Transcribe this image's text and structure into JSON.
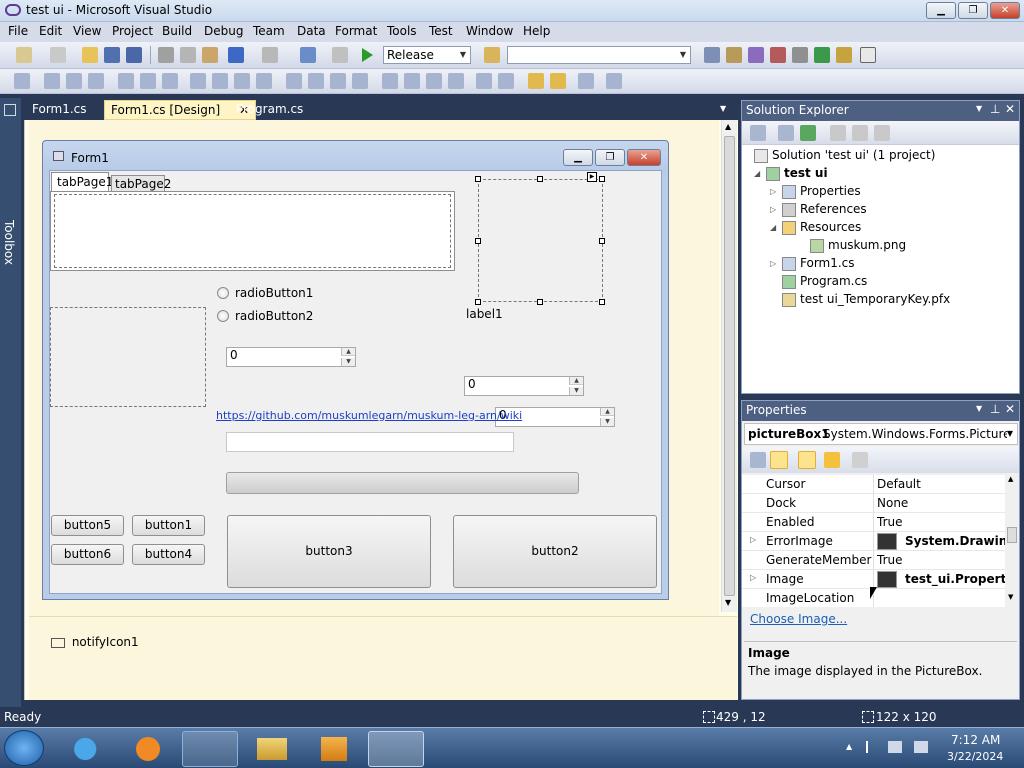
{
  "window": {
    "title": "test ui - Microsoft Visual Studio",
    "min": "▁",
    "max": "❐",
    "close": "✕"
  },
  "menu": [
    "File",
    "Edit",
    "View",
    "Project",
    "Build",
    "Debug",
    "Team",
    "Data",
    "Format",
    "Tools",
    "Test",
    "Window",
    "Help"
  ],
  "toolbar": {
    "config_value": "Release",
    "platform_value": ""
  },
  "toolbox": {
    "label": "Toolbox"
  },
  "doc_tabs": [
    {
      "label": "Form1.cs"
    },
    {
      "label": "Form1.cs [Design]"
    },
    {
      "label": "Program.cs"
    }
  ],
  "doc_tab_close": "✕",
  "form": {
    "title": "Form1",
    "tab_pages": [
      "tabPage1",
      "tabPage2"
    ],
    "radio1": "radioButton1",
    "radio2": "radioButton2",
    "label1": "label1",
    "num1": "0",
    "num2": "0",
    "num3": "0",
    "link": "https://github.com/muskumlegarn/muskum-leg-arn/wiki",
    "buttons": {
      "b1": "button1",
      "b2": "button2",
      "b3": "button3",
      "b4": "button4",
      "b5": "button5",
      "b6": "button6"
    }
  },
  "tray": {
    "notify": "notifyIcon1"
  },
  "solution_explorer": {
    "title": "Solution Explorer",
    "items": [
      {
        "label": "Solution 'test ui' (1 project)"
      },
      {
        "label": "test ui"
      },
      {
        "label": "Properties"
      },
      {
        "label": "References"
      },
      {
        "label": "Resources"
      },
      {
        "label": "muskum.png"
      },
      {
        "label": "Form1.cs"
      },
      {
        "label": "Program.cs"
      },
      {
        "label": "test ui_TemporaryKey.pfx"
      }
    ]
  },
  "properties": {
    "title": "Properties",
    "object_name": "pictureBox1",
    "object_type": "System.Windows.Forms.PictureBo",
    "rows": [
      {
        "name": "Cursor",
        "value": "Default"
      },
      {
        "name": "Dock",
        "value": "None"
      },
      {
        "name": "Enabled",
        "value": "True"
      },
      {
        "name": "ErrorImage",
        "value": "System.Drawing."
      },
      {
        "name": "GenerateMember",
        "value": "True"
      },
      {
        "name": "Image",
        "value": "test_ui.Properties"
      },
      {
        "name": "ImageLocation",
        "value": ""
      }
    ],
    "command": "Choose Image...",
    "desc_title": "Image",
    "desc_text": "The image displayed in the PictureBox."
  },
  "statusbar": {
    "text": "Ready",
    "position": "429 , 12",
    "size": "122 x 120"
  },
  "clock": {
    "time": "7:12 AM",
    "date": "3/22/2024"
  }
}
